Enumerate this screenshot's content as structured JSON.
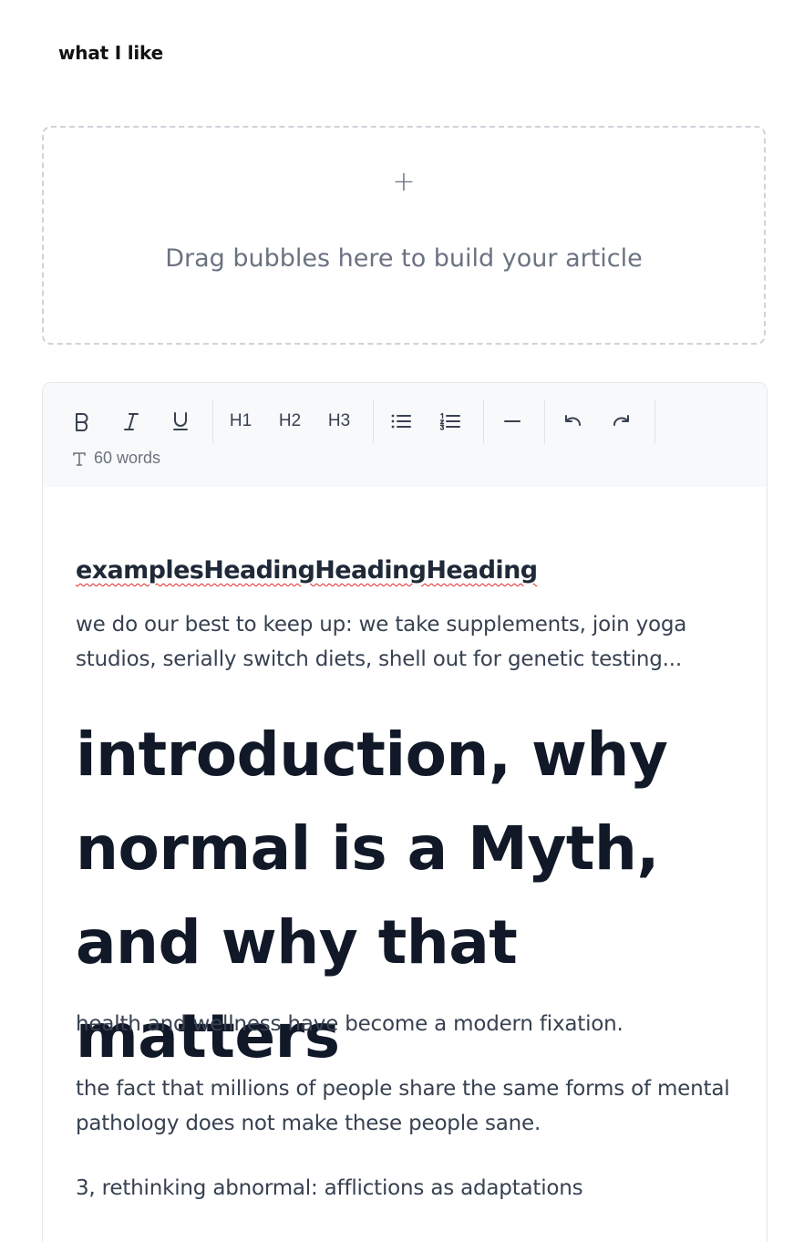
{
  "page": {
    "title": "what I like"
  },
  "dropzone": {
    "plus": "+",
    "text": "Drag bubbles here to build your article"
  },
  "toolbar": {
    "bold_icon": "bold-icon",
    "italic_icon": "italic-icon",
    "underline_icon": "underline-icon",
    "h1": "H1",
    "h2": "H2",
    "h3": "H3",
    "bullet_list_icon": "bullet-list-icon",
    "numbered_list_icon": "numbered-list-icon",
    "divider_icon": "horizontal-rule-icon",
    "undo_icon": "undo-icon",
    "redo_icon": "redo-icon",
    "word_count": "60 words"
  },
  "article": {
    "heading_small": "examplesHeadingHeadingHeading",
    "para1": "we do our best to keep up: we take supplements, join yoga studios, serially switch diets, shell out for genetic testing...",
    "heading_big": "introduction, why normal is a Myth, and why that matters",
    "para2": "health and wellness have become a modern fixation.",
    "para3": "the fact that millions of people share the same forms of mental pathology does not make these people sane.",
    "para4": "3, rethinking abnormal: afflictions as adaptations"
  },
  "colors": {
    "text_primary": "#111827",
    "text_secondary": "#374151",
    "muted": "#6b7280",
    "toolbar_bg": "#f8f9fa",
    "spellcheck": "#dc2626"
  }
}
